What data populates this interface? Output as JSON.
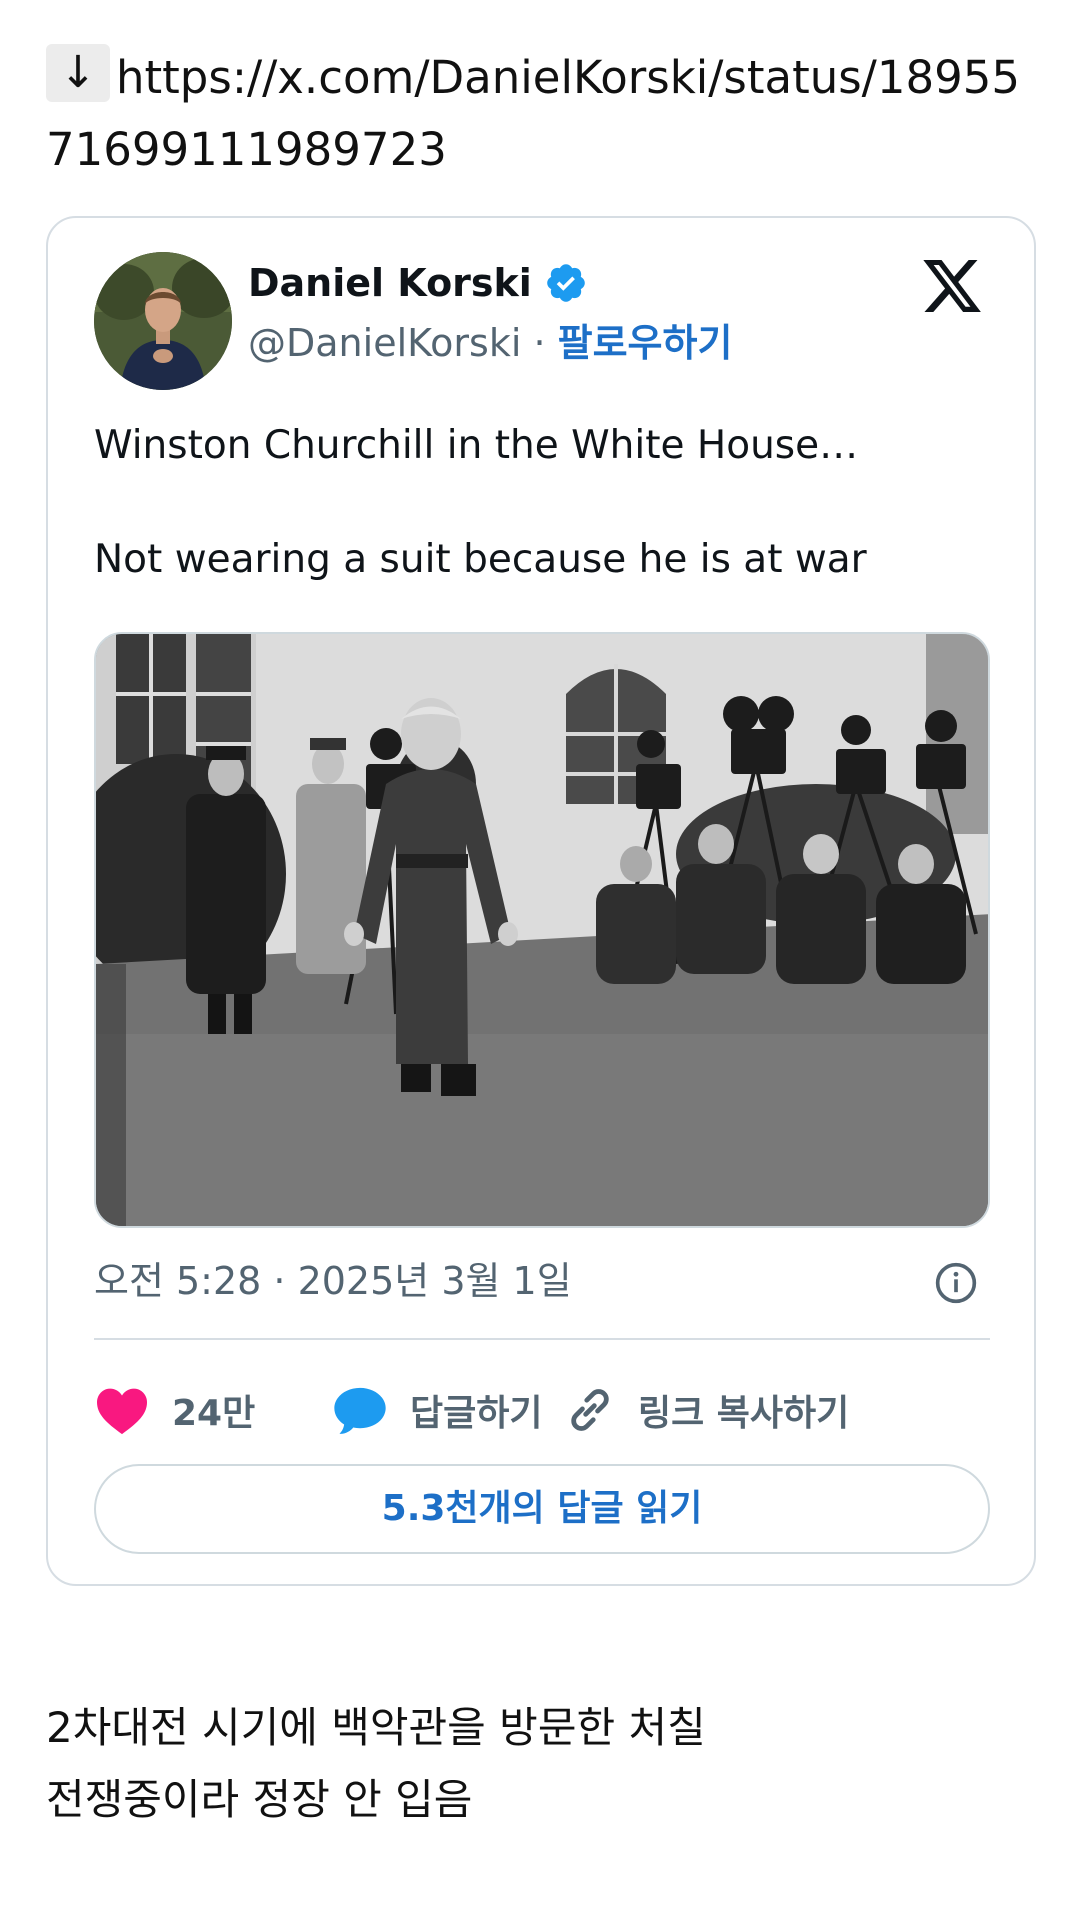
{
  "link": {
    "arrow": "↓",
    "url": "https://x.com/DanielKorski/status/1895571699111989723"
  },
  "tweet": {
    "display_name": "Daniel Korski",
    "handle": "@DanielKorski",
    "separator": " · ",
    "follow_label": "팔로우하기",
    "text_line1": "Winston Churchill in the White House…",
    "text_line2": "Not wearing a suit because he is at war",
    "timestamp": "오전 5:28 · 2025년 3월 1일",
    "likes_count": "24만",
    "reply_label": "답글하기",
    "copy_link_label": "링크 복사하기",
    "read_replies_label": "5.3천개의 답글 읽기"
  },
  "caption": {
    "line1": "2차대전 시기에 백악관을 방문한 처칠",
    "line2": "전쟁중이라 정장 안 입음"
  },
  "icons": {
    "verified": "verified-badge-icon",
    "x_logo": "x-logo-icon",
    "info": "info-icon",
    "like": "heart-icon",
    "reply": "reply-bubble-icon",
    "link": "link-icon"
  },
  "colors": {
    "verified_blue": "#1d9bf0",
    "heart_pink": "#f91880",
    "reply_blue": "#1d9bf0",
    "link_blue": "#1d6fc7",
    "muted_gray": "#536471"
  }
}
